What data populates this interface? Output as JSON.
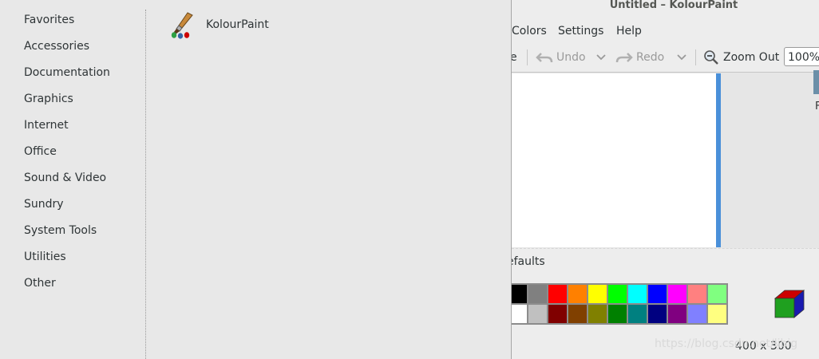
{
  "categories": [
    "Favorites",
    "Accessories",
    "Documentation",
    "Graphics",
    "Internet",
    "Office",
    "Sound & Video",
    "Sundry",
    "System Tools",
    "Utilities",
    "Other"
  ],
  "apps": {
    "kolourpaint": {
      "label": "KolourPaint",
      "icon": "paintbrush-icon"
    }
  },
  "window": {
    "title": "Untitled – KolourPaint",
    "menu": {
      "colors": "Colors",
      "settings": "Settings",
      "help": "Help"
    },
    "toolbar": {
      "partial": "e",
      "undo": "Undo",
      "redo": "Redo",
      "zoom_out": "Zoom Out",
      "zoom_value": "100%"
    },
    "colorbox_title": "efaults",
    "image_size": "400 x 300",
    "palette_top": [
      "#000000",
      "#808080",
      "#ff0000",
      "#ff8000",
      "#ffff00",
      "#00ff00",
      "#00ffff",
      "#0000ff",
      "#ff00ff",
      "#ff8080",
      "#80ff80"
    ],
    "palette_bottom": [
      "#ffffff",
      "#c0c0c0",
      "#800000",
      "#804000",
      "#808000",
      "#008000",
      "#008080",
      "#000080",
      "#800080",
      "#8080ff",
      "#ffff80"
    ]
  },
  "watermark": "https://blog.csdn.net/ljbig",
  "edge_char": "F"
}
